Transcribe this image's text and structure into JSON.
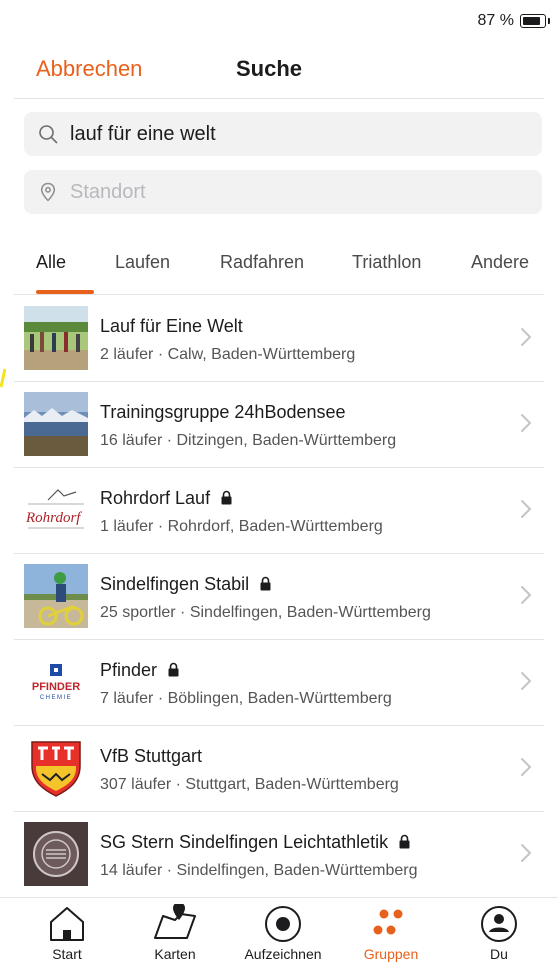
{
  "status_bar": {
    "battery": "87 %"
  },
  "nav": {
    "cancel": "Abbrechen",
    "title": "Suche"
  },
  "search": {
    "value": "lauf für eine welt",
    "icon": "search-icon"
  },
  "location": {
    "placeholder": "Standort",
    "icon": "location-pin-icon"
  },
  "tabs": [
    {
      "label": "Alle",
      "active": true
    },
    {
      "label": "Laufen"
    },
    {
      "label": "Radfahren"
    },
    {
      "label": "Triathlon"
    },
    {
      "label": "Andere"
    }
  ],
  "clubs": [
    {
      "name": "Lauf für Eine Welt",
      "meta": "2 läufer · Calw, Baden-Württemberg",
      "private": false
    },
    {
      "name": "Trainingsgruppe 24hBodensee",
      "meta": "16 läufer · Ditzingen, Baden-Württemberg",
      "private": false
    },
    {
      "name": "Rohrdorf Lauf",
      "meta": "1 läufer · Rohrdorf, Baden-Württemberg",
      "private": true,
      "logo_text": "Rohrdorf"
    },
    {
      "name": "Sindelfingen Stabil",
      "meta": "25 sportler · Sindelfingen, Baden-Württemberg",
      "private": true
    },
    {
      "name": "Pfinder",
      "meta": "7 läufer · Böblingen, Baden-Württemberg",
      "private": true,
      "logo_text": "PFINDER",
      "logo_sub": "CHEMIE"
    },
    {
      "name": "VfB Stuttgart",
      "meta": "307 läufer · Stuttgart, Baden-Württemberg",
      "private": false
    },
    {
      "name": "SG Stern Sindelfingen Leichtathletik",
      "meta": "14 läufer · Sindelfingen, Baden-Württemberg",
      "private": true
    }
  ],
  "tabbar": [
    {
      "label": "Start",
      "icon": "home-icon"
    },
    {
      "label": "Karten",
      "icon": "map-icon"
    },
    {
      "label": "Aufzeichnen",
      "icon": "record-icon"
    },
    {
      "label": "Gruppen",
      "icon": "groups-icon",
      "active": true
    },
    {
      "label": "Du",
      "icon": "profile-icon"
    }
  ],
  "colors": {
    "accent": "#e8611c",
    "text": "#1c1c1e",
    "secondary": "#555555",
    "field_bg": "#f2f2f3",
    "divider": "#e3e3e3"
  }
}
